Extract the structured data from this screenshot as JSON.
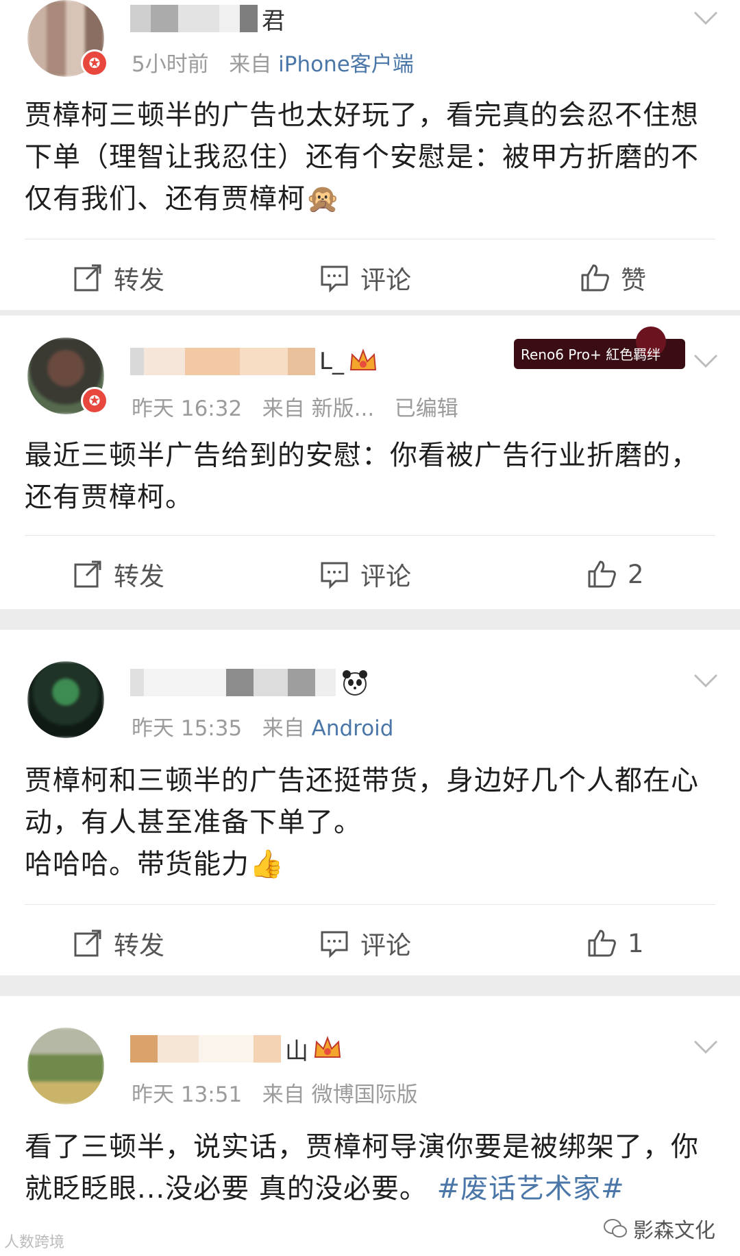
{
  "posts": [
    {
      "username_tail": "君",
      "time": "5小时前",
      "source_prefix": "来自",
      "source": "iPhone客户端",
      "content": "贾樟柯三顿半的广告也太好玩了，看完真的会忍不住想下单（理智让我忍住）还有个安慰是：被甲方折磨的不仅有我们、还有贾樟柯🙊",
      "actions": {
        "repost": "转发",
        "comment": "评论",
        "like": "赞"
      }
    },
    {
      "username_tail": "L_",
      "badge_text": "Reno6 Pro+ 紅色羁绊",
      "time": "昨天 16:32",
      "source_prefix": "来自",
      "source": "新版...",
      "edited": "已编辑",
      "content": "最近三顿半广告给到的安慰：你看被广告行业折磨的，还有贾樟柯。",
      "actions": {
        "repost": "转发",
        "comment": "评论",
        "like": "2"
      }
    },
    {
      "username_tail": "",
      "time": "昨天 15:35",
      "source_prefix": "来自",
      "source": "Android",
      "content_line1": "贾樟柯和三顿半的广告还挺带货，身边好几个人都在心动，有人甚至准备下单了。",
      "content_line2": "哈哈哈。带货能力👍",
      "actions": {
        "repost": "转发",
        "comment": "评论",
        "like": "1"
      }
    },
    {
      "username_tail": "山",
      "time": "昨天 13:51",
      "source_prefix": "来自",
      "source": "微博国际版",
      "content": "看了三顿半，说实话，贾樟柯导演你要是被绑架了，你就眨眨眼...没必要 真的没必要。",
      "hashtag": "#废话艺术家#"
    }
  ],
  "watermark": "影森文化",
  "watermark2": "人数跨境",
  "colors": {
    "link": "#4a76a8",
    "meta": "#9b9b9b",
    "badge_red": "#e8473e"
  }
}
